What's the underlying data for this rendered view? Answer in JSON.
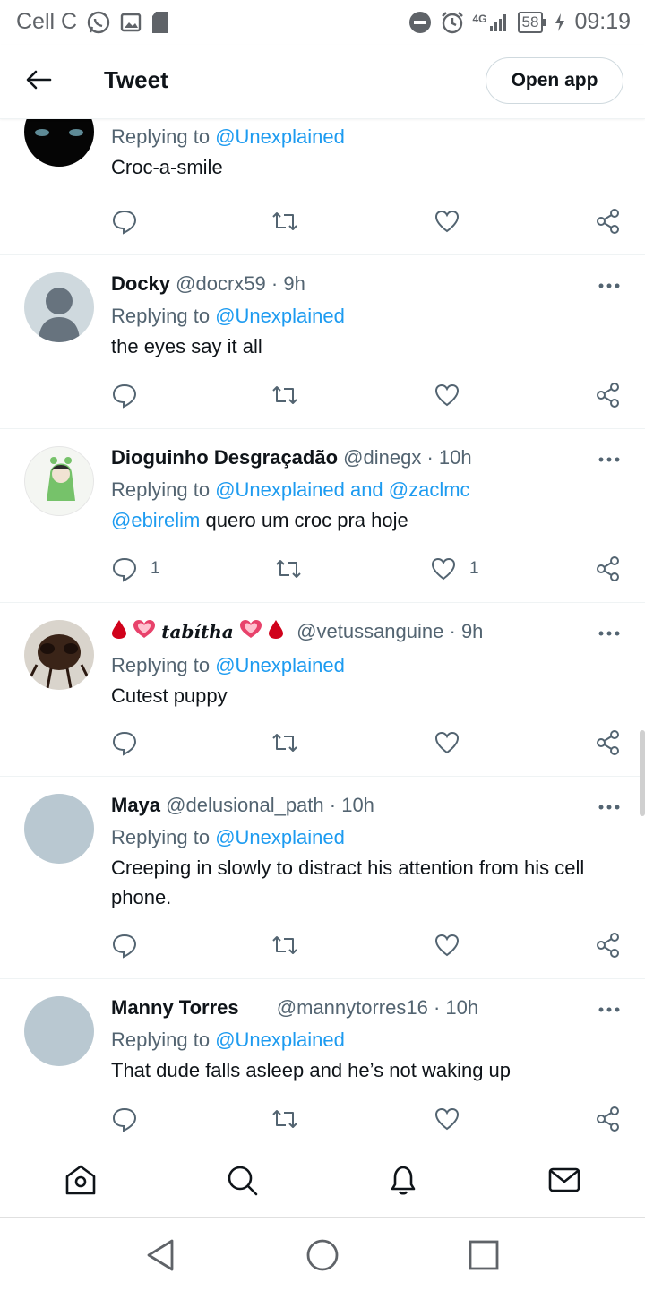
{
  "statusbar": {
    "carrier": "Cell C",
    "network": "4G",
    "battery": "58",
    "time": "09:19"
  },
  "header": {
    "title": "Tweet",
    "open_app": "Open app"
  },
  "tweets": [
    {
      "name": "",
      "handle": "",
      "time": "",
      "replying_prefix": "Replying to",
      "replying_to": "@Unexplained",
      "text": "Croc-a-smile",
      "mention": "",
      "reply_count": "",
      "like_count": ""
    },
    {
      "name": "Docky",
      "handle": "@docrx59",
      "time": "· 9h",
      "replying_prefix": "Replying to",
      "replying_to": "@Unexplained",
      "text": "the eyes say it all",
      "mention": "",
      "reply_count": "",
      "like_count": ""
    },
    {
      "name": "Dioguinho Desgraçadão",
      "handle": "@dinegx",
      "time": "· 10h",
      "replying_prefix": "Replying to",
      "replying_to": "@Unexplained and @zaclmc",
      "text": "quero um croc pra hoje",
      "mention": "@ebirelim",
      "reply_count": "1",
      "like_count": "1"
    },
    {
      "name": "tabítha",
      "handle": "@vetussanguine",
      "time": "· 9h",
      "replying_prefix": "Replying to",
      "replying_to": "@Unexplained",
      "text": "Cutest puppy",
      "mention": "",
      "reply_count": "",
      "like_count": ""
    },
    {
      "name": "Maya",
      "handle": "@delusional_path",
      "time": "· 10h",
      "replying_prefix": "Replying to",
      "replying_to": "@Unexplained",
      "text": "Creeping in slowly to distract his attention from his cell phone.",
      "mention": "",
      "reply_count": "",
      "like_count": ""
    },
    {
      "name": "Manny Torres",
      "handle": "@mannytorres16",
      "time": "· 10h",
      "replying_prefix": "Replying to",
      "replying_to": "@Unexplained",
      "text": "That dude falls asleep and he’s not waking up",
      "mention": "",
      "reply_count": "",
      "like_count": ""
    }
  ],
  "colors": {
    "link": "#1d9bf0",
    "secondary": "#536471",
    "primary_text": "#0f1419"
  },
  "icons": [
    "reply-icon",
    "retweet-icon",
    "like-icon",
    "share-icon",
    "home-icon",
    "search-icon",
    "notifications-icon",
    "messages-icon"
  ]
}
